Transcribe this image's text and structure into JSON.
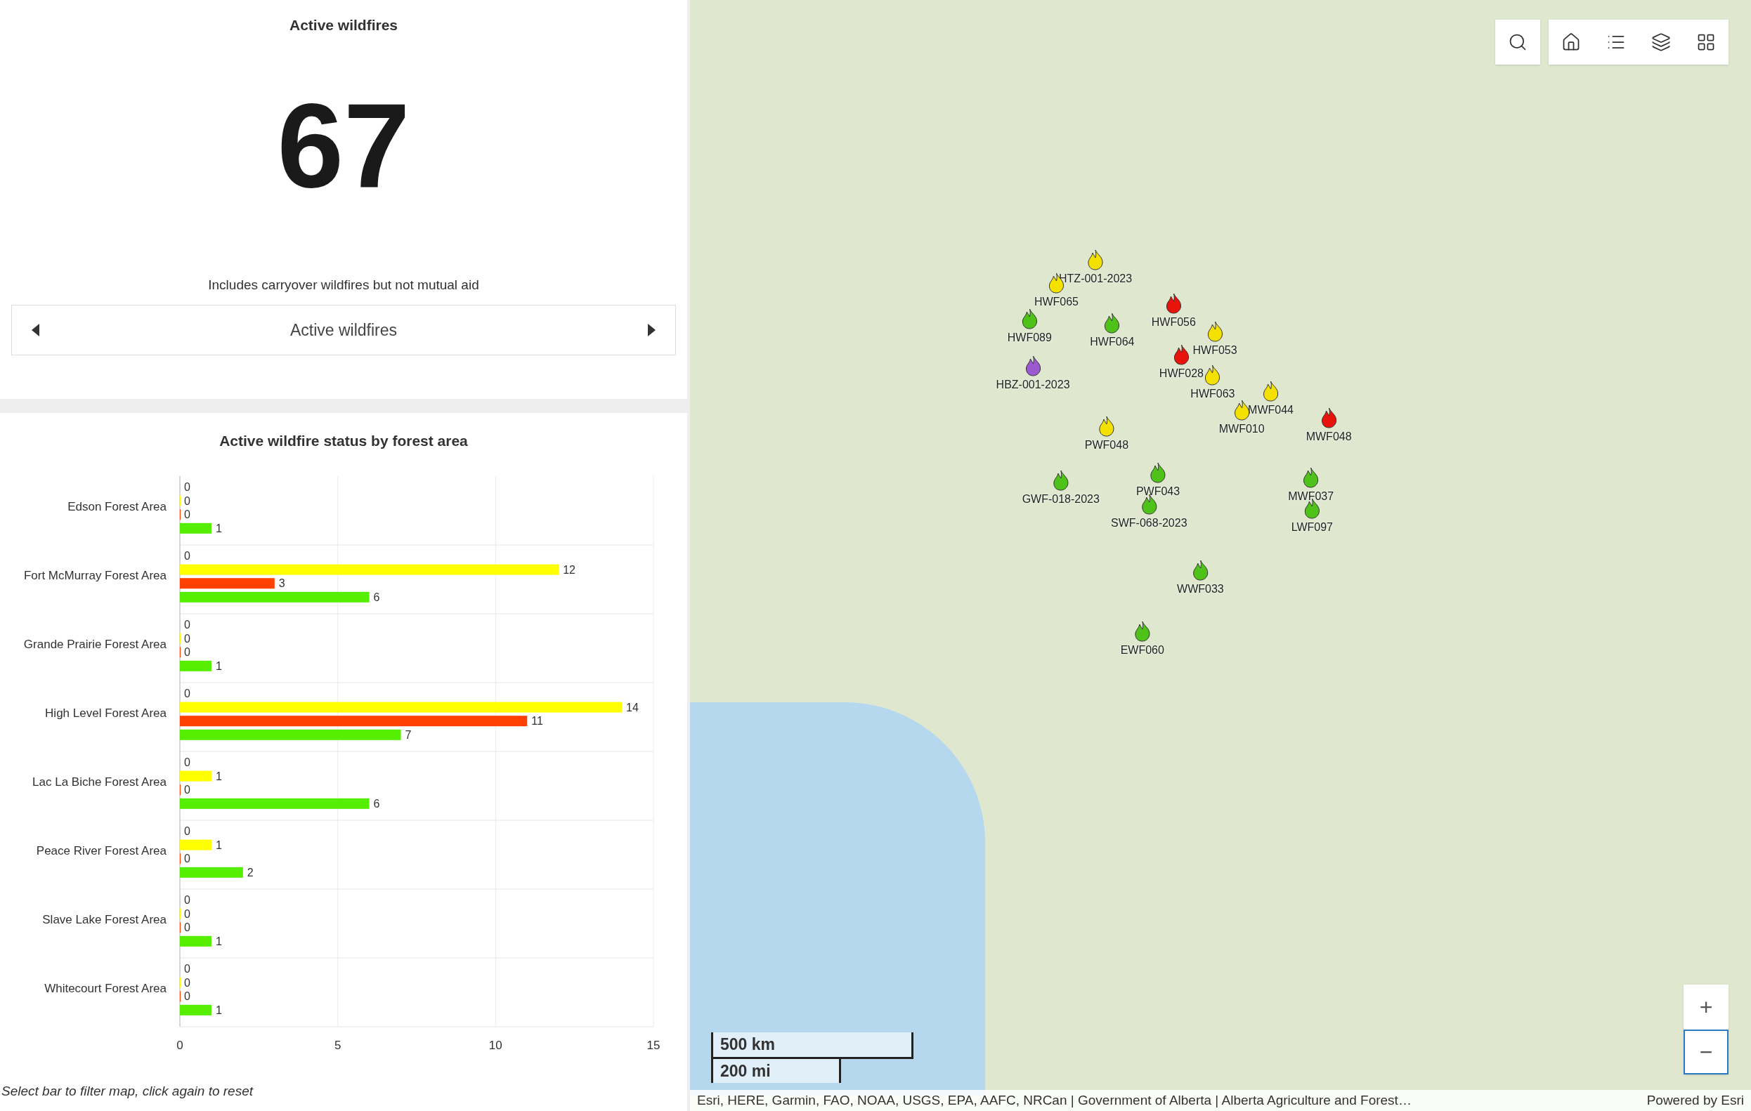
{
  "indicator": {
    "title": "Active wildfires",
    "value": "67",
    "note": "Includes carryover wildfires but not mutual aid",
    "nav_label": "Active wildfires"
  },
  "chart_panel": {
    "title": "Active wildfire status by forest area",
    "footer": "Select bar to filter map, click again to reset",
    "chart_data": {
      "type": "bar",
      "orientation": "horizontal",
      "categories": [
        "Edson Forest Area",
        "Fort McMurray Forest Area",
        "Grande Prairie Forest Area",
        "High Level Forest Area",
        "Lac La Biche Forest Area",
        "Peace River Forest Area",
        "Slave Lake Forest Area",
        "Whitecourt Forest Area"
      ],
      "series": [
        {
          "values": [
            0,
            0,
            0,
            0,
            0,
            0,
            0,
            0
          ]
        },
        {
          "color": "#ffff00",
          "values": [
            0,
            12,
            0,
            14,
            1,
            1,
            0,
            0
          ]
        },
        {
          "color": "#ff4000",
          "values": [
            0,
            3,
            0,
            11,
            0,
            0,
            0,
            0
          ]
        },
        {
          "color": "#55ee00",
          "values": [
            1,
            6,
            1,
            7,
            6,
            2,
            1,
            1
          ]
        }
      ],
      "xlim": [
        0,
        15
      ],
      "xticks": [
        0,
        5,
        10,
        15
      ],
      "data_labels": true
    }
  },
  "map": {
    "fires": [
      {
        "label": "HTZ-001-2023",
        "color": "#f5e100"
      },
      {
        "label": "HWF065",
        "color": "#f5e100"
      },
      {
        "label": "HWF089",
        "color": "#4fc21a"
      },
      {
        "label": "HWF056",
        "color": "#e8140c"
      },
      {
        "label": "HWF064",
        "color": "#4fc21a"
      },
      {
        "label": "HWF053",
        "color": "#f5e100"
      },
      {
        "label": "HWF028",
        "color": "#e8140c"
      },
      {
        "label": "HBZ-001-2023",
        "color": "#9b59d0"
      },
      {
        "label": "HWF063",
        "color": "#f5e100"
      },
      {
        "label": "MWF044",
        "color": "#f5e100"
      },
      {
        "label": "MWF010",
        "color": "#f5e100"
      },
      {
        "label": "MWF048",
        "color": "#e8140c"
      },
      {
        "label": "PWF048",
        "color": "#f5e100"
      },
      {
        "label": "PWF043",
        "color": "#4fc21a"
      },
      {
        "label": "GWF-018-2023",
        "color": "#4fc21a"
      },
      {
        "label": "SWF-068-2023",
        "color": "#4fc21a"
      },
      {
        "label": "MWF037",
        "color": "#4fc21a"
      },
      {
        "label": "LWF097",
        "color": "#4fc21a"
      },
      {
        "label": "WWF033",
        "color": "#4fc21a"
      },
      {
        "label": "EWF060",
        "color": "#4fc21a"
      }
    ],
    "scale": {
      "metric": "500 km",
      "imperial": "200 mi"
    },
    "zoom_in": "+",
    "zoom_out": "−",
    "attribution": "Esri, HERE, Garmin, FAO, NOAA, USGS, EPA, AAFC, NRCan | Government of Alberta | Alberta Agriculture and Forest…",
    "powered_by": "Powered by Esri"
  }
}
